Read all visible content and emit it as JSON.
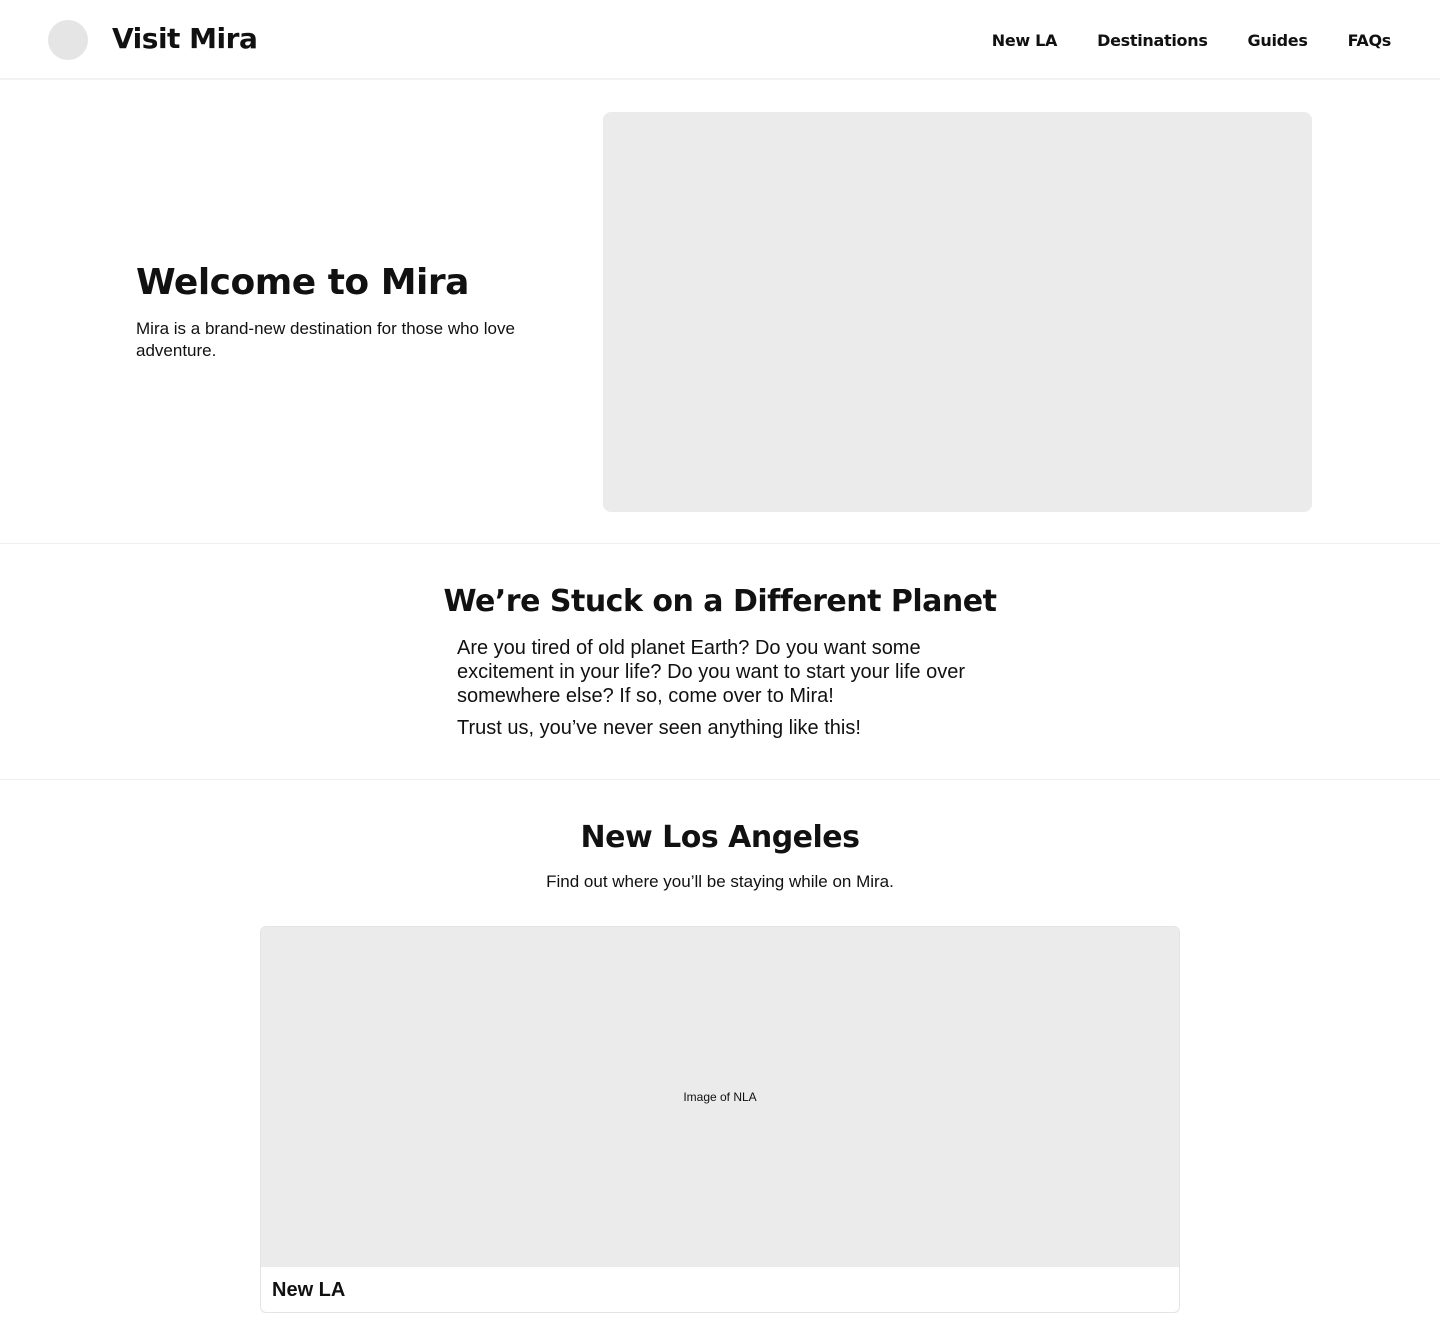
{
  "header": {
    "brand": "Visit Mira",
    "nav": [
      "New LA",
      "Destinations",
      "Guides",
      "FAQs"
    ]
  },
  "hero": {
    "title": "Welcome to Mira",
    "text": "Mira is a brand-new destination for those who love adventure."
  },
  "intro": {
    "title": "We’re Stuck on a Different Planet",
    "p1": "Are you tired of old planet Earth? Do you want some excitement in your life? Do you want to start your life over somewhere else? If so, come over to Mira!",
    "p2": "Trust us, you’ve never seen anything like this!"
  },
  "nla": {
    "title": "New Los Angeles",
    "subtitle": "Find out where you’ll be staying while on Mira.",
    "card": {
      "image_label": "Image of NLA",
      "title": "New LA"
    }
  }
}
